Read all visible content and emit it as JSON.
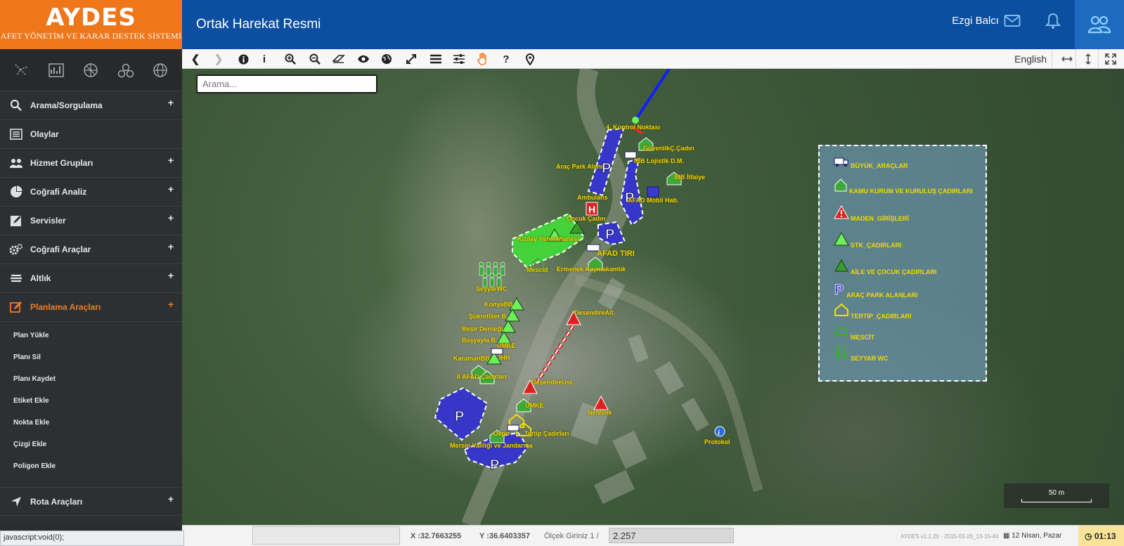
{
  "brand": {
    "logo": "AYDES",
    "subtitle": "AFET YÖNETİM VE KARAR DESTEK SİSTEMİ"
  },
  "header": {
    "page_title": "Ortak Harekat Resmi",
    "user_name": "Ezgi Balcı"
  },
  "sidebar": {
    "menu": [
      {
        "label": "Arama/Sorgulama",
        "expand": "+"
      },
      {
        "label": "Olaylar",
        "expand": ""
      },
      {
        "label": "Hizmet Grupları",
        "expand": "+"
      },
      {
        "label": "Coğrafi Analiz",
        "expand": "+"
      },
      {
        "label": "Servisler",
        "expand": "+"
      },
      {
        "label": "Coğrafi Araçlar",
        "expand": "+"
      },
      {
        "label": "Altlık",
        "expand": "+"
      },
      {
        "label": "Planlama Araçları",
        "expand": "+"
      }
    ],
    "submenu": [
      "Plan Yükle",
      "Planı Sil",
      "Planı Kaydet",
      "Etiket Ekle",
      "Nokta Ekle",
      "Çizgi Ekle",
      "Poligon Ekle"
    ],
    "route": {
      "label": "Rota Araçları",
      "expand": "+"
    }
  },
  "toolbar": {
    "language": "English"
  },
  "map": {
    "search_placeholder": "Arama...",
    "scale_label": "50 m",
    "labels": [
      "4. Kontrol Noktası",
      "GüvenlikÇ.Çadırı",
      "İBB Lojistik D.M.",
      "Araç Park Alanı",
      "İBB İtfaiye",
      "AFAD Mobil Hab.",
      "Ambulans",
      "Çocuk Çadırı",
      "Kızılay Yemekhanesi",
      "AFAD TIRI",
      "Mescid",
      "Ermenek Kaymakamlık",
      "SeyyarWC",
      "DesendireAlt.",
      "KonyaBB",
      "Şükretliler B.",
      "Beşir Derneği",
      "Başyayla B.",
      "UMKE",
      "KaramanBB",
      "İHH",
      "İl AFAD Çadırları",
      "DesendireUst.",
      "UMKE",
      "Nefeslik",
      "Depo",
      "Tertip Çadırları",
      "Mersin Valiliği ve Jandarma",
      "Protokol"
    ],
    "legend": [
      {
        "label": "BÜYÜK_ARAÇLAR",
        "icon": "truck-icon"
      },
      {
        "label": "KAMU KURUM VE KURULUŞ ÇADIRLARI",
        "icon": "green-tent-icon"
      },
      {
        "label": "MADEN_GİRİŞLERİ",
        "icon": "warning-icon"
      },
      {
        "label": "STK_ÇADIRLARI",
        "icon": "stk-tent-icon"
      },
      {
        "label": "AİLE VE ÇOCUK ÇADIRLARI",
        "icon": "family-tent-icon"
      },
      {
        "label": "ARAÇ PARK ALANLARI",
        "icon": "parking-icon"
      },
      {
        "label": "TERTİP_ÇADIRLARI",
        "icon": "house-icon"
      },
      {
        "label": "MESCİT",
        "icon": "mosque-icon"
      },
      {
        "label": "SEYYAR WC",
        "icon": "wc-icon"
      }
    ]
  },
  "statusbar": {
    "x": "X :32.7663255",
    "y": "Y :36.6403357",
    "scale_label": "Ölçek Giriniz 1 /",
    "scale_value": "2.257",
    "version": "AYDES v1.1.20 - 2015-03-26_13-15-44",
    "date": "12 Nisan, Pazar",
    "clock": "01:13",
    "browser_status": "javascript:void(0);"
  },
  "colors": {
    "brand_orange": "#f0761a",
    "header_blue": "#0c4fa1",
    "sidebar": "#2d3033",
    "label_yellow": "#f2d300",
    "parking_blue": "#3636c8",
    "kizilay_green": "#44d23a"
  }
}
